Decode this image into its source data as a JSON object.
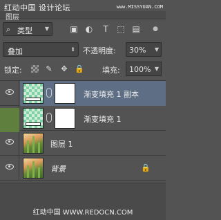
{
  "watermark": {
    "top_left": "红动中国 设计论坛",
    "top_right": "www.MISSYUAN.COM",
    "bottom": "红动中国 WWW.REDOCN.COM"
  },
  "panel": {
    "tab_label": "图层"
  },
  "filter": {
    "kind_label": "类型",
    "icons": [
      "image-filter-icon",
      "adjustment-filter-icon",
      "type-filter-icon",
      "shape-filter-icon",
      "smart-object-filter-icon"
    ]
  },
  "blend": {
    "mode": "叠加",
    "opacity_label": "不透明度:",
    "opacity_value": "30%"
  },
  "lock": {
    "label": "锁定:",
    "fill_label": "填充:",
    "fill_value": "100%"
  },
  "layers": [
    {
      "name": "渐变填充 1 副本",
      "type": "gradient-fill",
      "selected": true,
      "visible": true
    },
    {
      "name": "渐变填充 1",
      "type": "gradient-fill",
      "selected": false,
      "visible": true
    },
    {
      "name": "图层 1",
      "type": "pixel",
      "selected": false,
      "visible": true
    },
    {
      "name": "背景",
      "type": "background",
      "selected": false,
      "visible": true,
      "locked": true
    }
  ]
}
